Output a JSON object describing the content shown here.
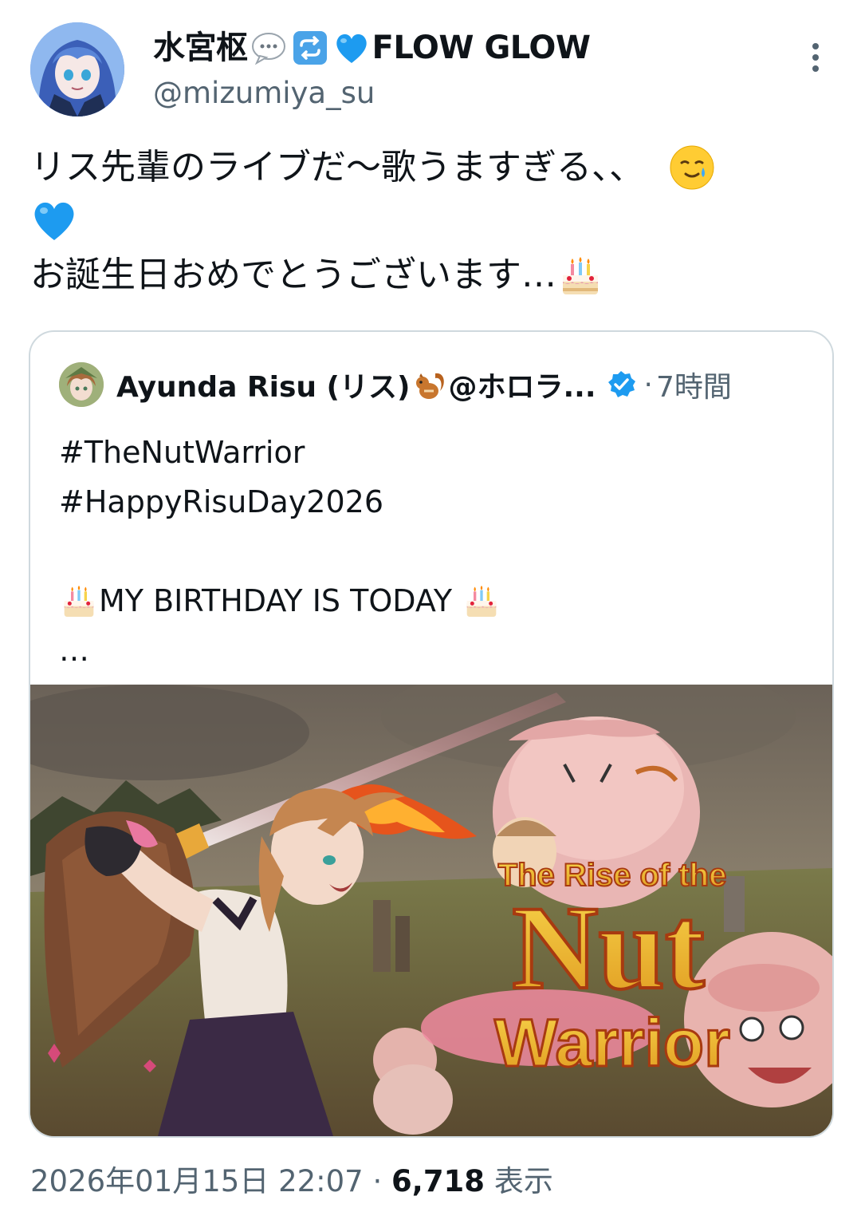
{
  "author": {
    "display_name": "水宮枢",
    "handle": "@mizumiya_su",
    "name_suffix": "FLOW GLOW"
  },
  "tweet": {
    "line1": "リス先輩のライブだ〜歌うますぎる、、",
    "line3": "お誕生日おめでとうございます…"
  },
  "quote": {
    "name": "Ayunda Risu (リス)",
    "name_suffix": "@ホロラ...",
    "separator": "·",
    "time": "7時間",
    "body": {
      "line1": "#TheNutWarrior",
      "line2": "#HappyRisuDay2026",
      "line4": "MY BIRTHDAY IS TODAY",
      "line5": "…"
    },
    "image": {
      "title_line1": "The Rise of the",
      "title_line2": "Nut",
      "title_line3": "Warrior"
    }
  },
  "meta": {
    "timestamp": "2026年01月15日 22:07",
    "separator": "·",
    "views": "6,718",
    "views_label": "表示"
  },
  "colors": {
    "text": "#0f1419",
    "secondary": "#536471",
    "border": "#cfd9de",
    "verified": "#1d9bf0",
    "heart": "#1d9bf0"
  }
}
